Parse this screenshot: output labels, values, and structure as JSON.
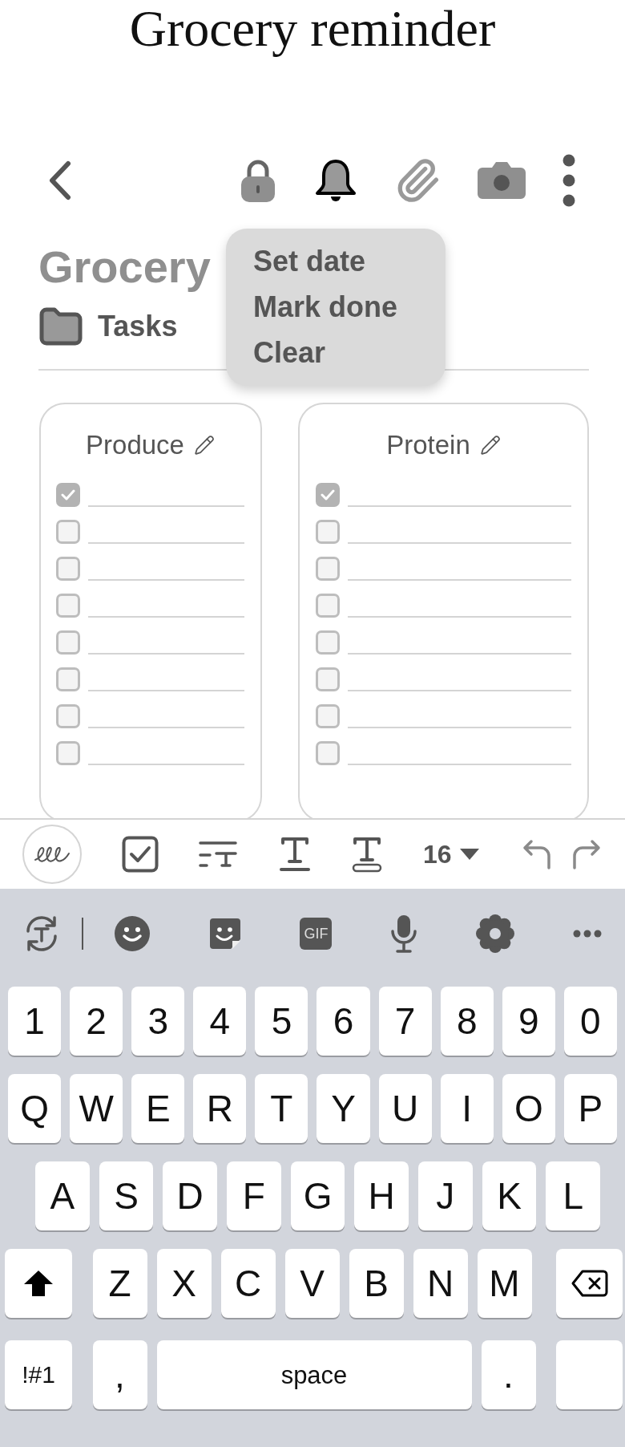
{
  "title": "Grocery reminder",
  "app_bar": {
    "actions": [
      {
        "kind": "lock",
        "selected": false
      },
      {
        "kind": "bell",
        "selected": true
      },
      {
        "kind": "attach",
        "selected": false
      },
      {
        "kind": "camera",
        "selected": false
      },
      {
        "kind": "more",
        "selected": false
      }
    ]
  },
  "menu": {
    "items": [
      "Set date",
      "Mark done",
      "Clear"
    ]
  },
  "note": {
    "title": "Grocery",
    "folder": "Tasks"
  },
  "lists": [
    {
      "title": "Produce",
      "items": [
        {
          "checked": true
        },
        {
          "checked": false
        },
        {
          "checked": false
        },
        {
          "checked": false
        },
        {
          "checked": false
        },
        {
          "checked": false
        },
        {
          "checked": false
        },
        {
          "checked": false
        }
      ]
    },
    {
      "title": "Protein",
      "items": [
        {
          "checked": true
        },
        {
          "checked": false
        },
        {
          "checked": false
        },
        {
          "checked": false
        },
        {
          "checked": false
        },
        {
          "checked": false
        },
        {
          "checked": false
        },
        {
          "checked": false
        }
      ]
    }
  ],
  "format_bar": {
    "font_size": "16"
  },
  "keyboard": {
    "gif": "GIF",
    "rows": [
      {
        "keys": [
          {
            "kind": "char",
            "label": "1"
          },
          {
            "kind": "char",
            "label": "2"
          },
          {
            "kind": "char",
            "label": "3"
          },
          {
            "kind": "char",
            "label": "4"
          },
          {
            "kind": "char",
            "label": "5"
          },
          {
            "kind": "char",
            "label": "6"
          },
          {
            "kind": "char",
            "label": "7"
          },
          {
            "kind": "char",
            "label": "8"
          },
          {
            "kind": "char",
            "label": "9"
          },
          {
            "kind": "char",
            "label": "0"
          }
        ]
      },
      {
        "keys": [
          {
            "kind": "char",
            "label": "Q"
          },
          {
            "kind": "char",
            "label": "W"
          },
          {
            "kind": "char",
            "label": "E"
          },
          {
            "kind": "char",
            "label": "R"
          },
          {
            "kind": "char",
            "label": "T"
          },
          {
            "kind": "char",
            "label": "Y"
          },
          {
            "kind": "char",
            "label": "U"
          },
          {
            "kind": "char",
            "label": "I"
          },
          {
            "kind": "char",
            "label": "O"
          },
          {
            "kind": "char",
            "label": "P"
          }
        ]
      },
      {
        "keys": [
          {
            "kind": "char",
            "label": "A"
          },
          {
            "kind": "char",
            "label": "S"
          },
          {
            "kind": "char",
            "label": "D"
          },
          {
            "kind": "char",
            "label": "F"
          },
          {
            "kind": "char",
            "label": "G"
          },
          {
            "kind": "char",
            "label": "H"
          },
          {
            "kind": "char",
            "label": "J"
          },
          {
            "kind": "char",
            "label": "K"
          },
          {
            "kind": "char",
            "label": "L"
          }
        ]
      },
      {
        "keys": [
          {
            "kind": "shift"
          },
          {
            "kind": "char",
            "label": "Z"
          },
          {
            "kind": "char",
            "label": "X"
          },
          {
            "kind": "char",
            "label": "C"
          },
          {
            "kind": "char",
            "label": "V"
          },
          {
            "kind": "char",
            "label": "B"
          },
          {
            "kind": "char",
            "label": "N"
          },
          {
            "kind": "char",
            "label": "M"
          },
          {
            "kind": "backspace"
          }
        ]
      },
      {
        "keys": [
          {
            "kind": "mode",
            "label": "!#1"
          },
          {
            "kind": "char",
            "label": ","
          },
          {
            "kind": "space",
            "label": "space"
          },
          {
            "kind": "char",
            "label": "."
          },
          {
            "kind": "blank"
          }
        ]
      }
    ]
  }
}
